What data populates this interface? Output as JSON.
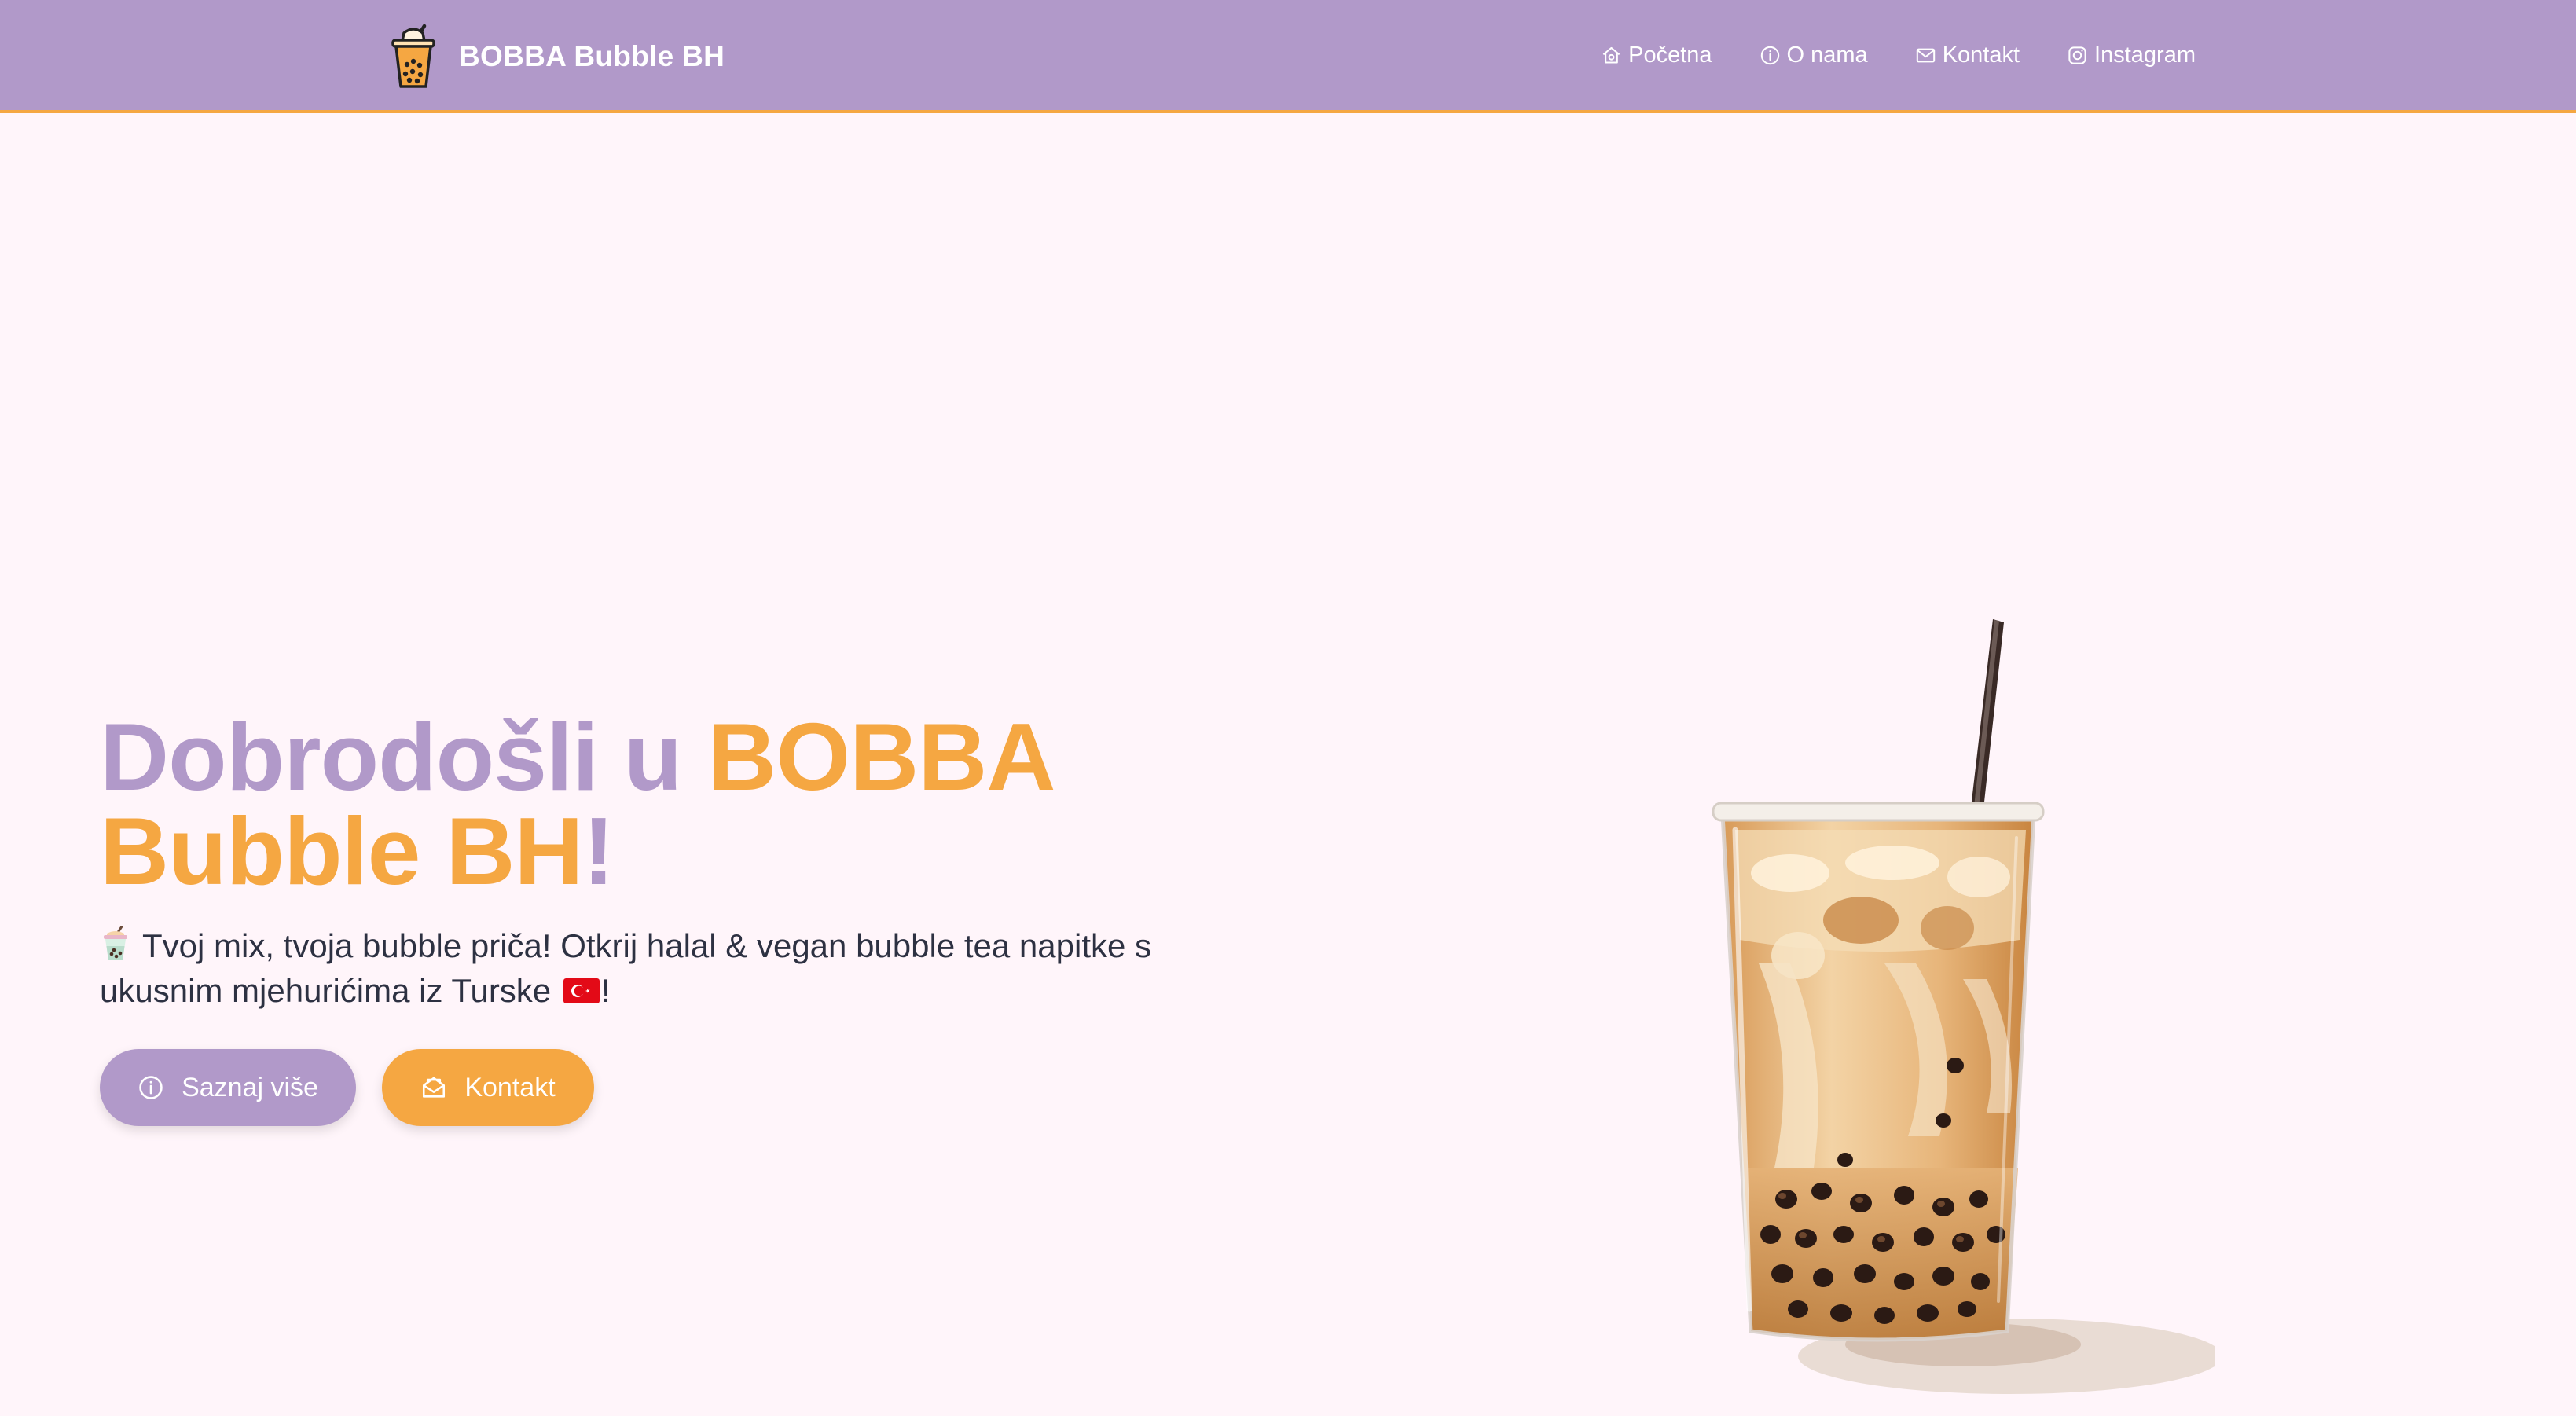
{
  "brand": {
    "name": "BOBBA Bubble BH",
    "logo_icon": "bubble-tea-cup-icon"
  },
  "nav": {
    "items": [
      {
        "label": "Početna",
        "icon": "home-icon"
      },
      {
        "label": "O nama",
        "icon": "info-icon"
      },
      {
        "label": "Kontakt",
        "icon": "envelope-icon"
      },
      {
        "label": "Instagram",
        "icon": "instagram-icon"
      }
    ]
  },
  "hero": {
    "title_part1": "Dobrodošli u ",
    "title_part2": "BOBBA Bubble BH",
    "title_part3": "!",
    "subtitle_part1": "Tvoj mix, tvoja bubble priča! Otkrij halal & vegan bubble tea napitke s ukusnim mjehurićima iz Turske",
    "subtitle_part2": "!",
    "subtitle_icons": [
      "bubble-tea-emoji-icon",
      "turkey-flag-icon"
    ],
    "buttons": {
      "more_label": "Saznaj više",
      "more_icon": "info-icon",
      "contact_label": "Kontakt",
      "contact_icon": "envelope-open-icon"
    },
    "illustration": "bubble-tea-drink-image"
  },
  "colors": {
    "nav_bg": "#b199c9",
    "accent_orange": "#f5a742",
    "accent_purple": "#b199c9",
    "page_bg": "#fff5fa",
    "text_dark": "#2d3142"
  }
}
